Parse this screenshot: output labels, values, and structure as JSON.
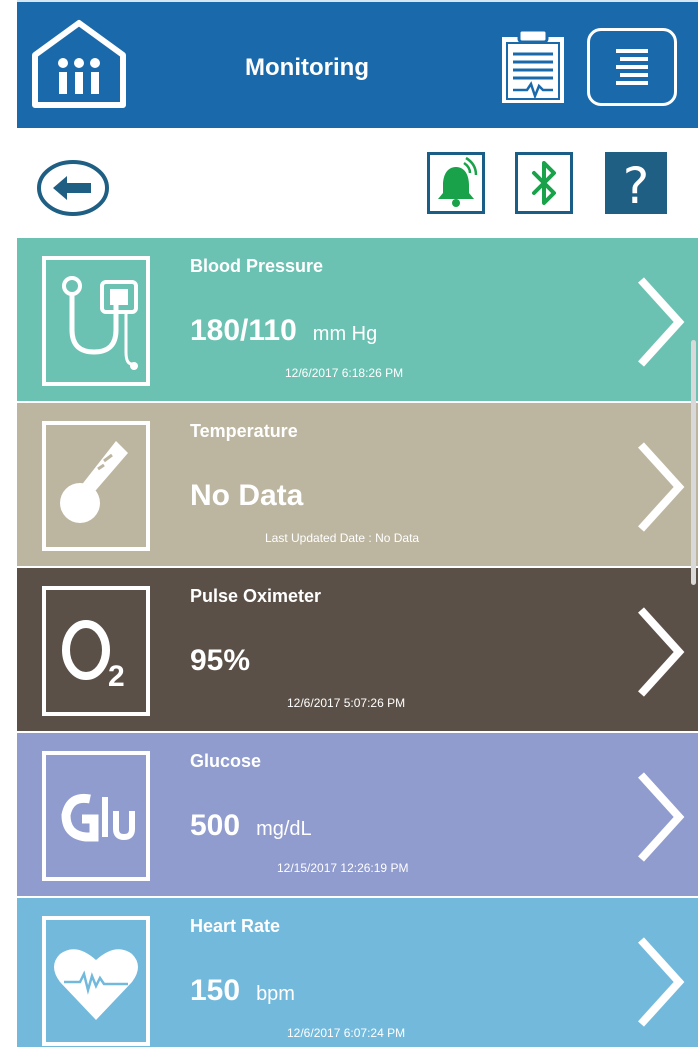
{
  "header": {
    "title": "Monitoring",
    "home_icon": "home-users-icon",
    "clipboard_icon": "clipboard-report-icon",
    "menu_icon": "menu-list-icon"
  },
  "toolbar": {
    "back_icon": "arrow-left-icon",
    "alarm_icon": "bell-alert-icon",
    "bluetooth_icon": "bluetooth-icon",
    "help_label": "?"
  },
  "readings": [
    {
      "title": "Blood Pressure",
      "value": "180/110",
      "unit": "mm Hg",
      "time": "12/6/2017 6:18:26 PM",
      "color": "#6cc2b2",
      "icon": "blood-pressure-cuff-icon"
    },
    {
      "title": "Temperature",
      "value": "No Data",
      "unit": "",
      "time": "Last Updated  Date : No Data",
      "color": "#bcb5a0",
      "icon": "thermometer-icon"
    },
    {
      "title": "Pulse Oximeter",
      "value": "95%",
      "unit": "",
      "time": "12/6/2017 5:07:26 PM",
      "color": "#5b5048",
      "icon": "o2-icon"
    },
    {
      "title": "Glucose",
      "value": "500",
      "unit": "mg/dL",
      "time": "12/15/2017 12:26:19 PM",
      "color": "#909bce",
      "icon": "glucose-icon"
    },
    {
      "title": "Heart Rate",
      "value": "150",
      "unit": "bpm",
      "time": "12/6/2017 6:07:24 PM",
      "color": "#72b9dc",
      "icon": "heart-pulse-icon"
    }
  ],
  "colors": {
    "header_bg": "#1a6aab",
    "accent_green": "#1aa24a",
    "help_bg": "#1f5f84"
  }
}
